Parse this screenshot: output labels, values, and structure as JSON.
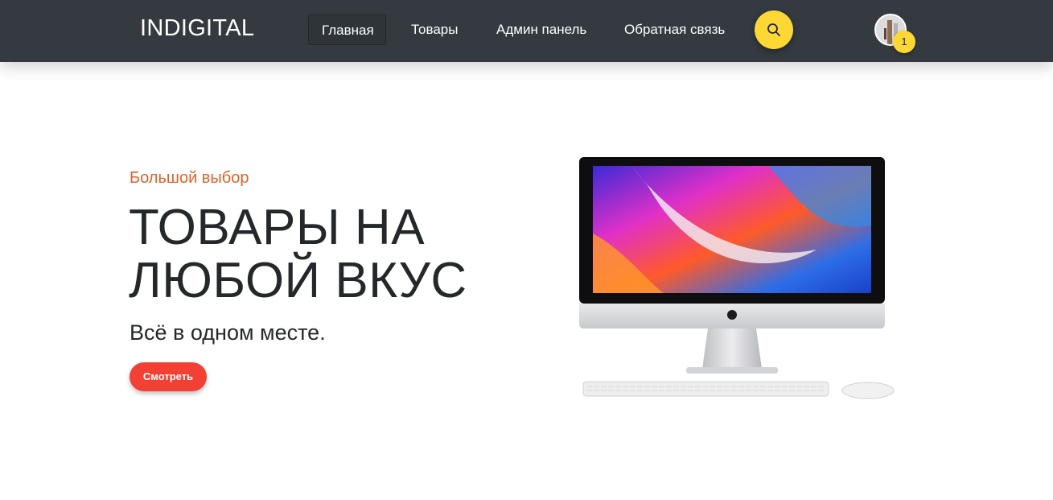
{
  "header": {
    "logo": "INDIGITAL",
    "nav": [
      {
        "label": "Главная",
        "active": true
      },
      {
        "label": "Товары",
        "active": false
      },
      {
        "label": "Админ панель",
        "active": false
      },
      {
        "label": "Обратная связь",
        "active": false
      }
    ],
    "search_icon": "search-icon",
    "cart_count": "1"
  },
  "hero": {
    "eyebrow": "Большой выбор",
    "title": "ТОВАРЫ НА ЛЮБОЙ ВКУС",
    "subtitle": "Всё в одном месте.",
    "button": "Смотреть",
    "image": "imac-with-keyboard-and-mouse"
  },
  "colors": {
    "header_bg": "#343a40",
    "accent_yellow": "#fdd835",
    "eyebrow_orange": "#e0622a",
    "button_red": "#f24034"
  }
}
